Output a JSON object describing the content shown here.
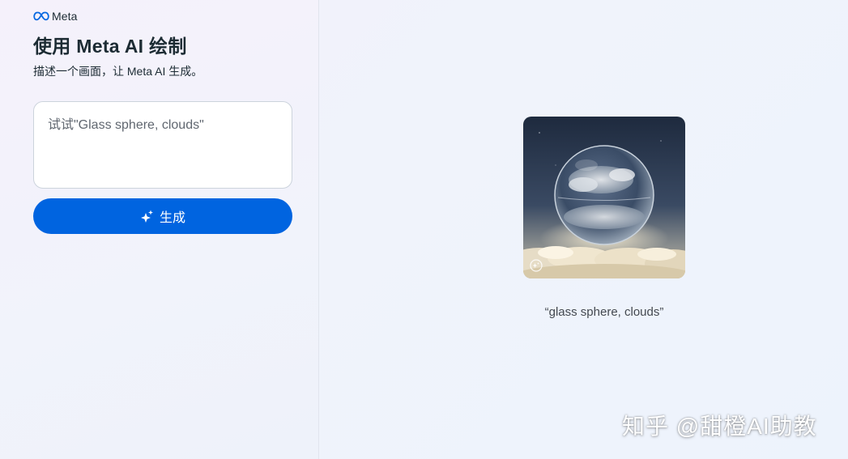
{
  "header": {
    "brand_name": "Meta",
    "logo_icon": "meta-infinity-icon"
  },
  "composer": {
    "title": "使用 Meta AI 绘制",
    "subtitle": "描述一个画面，让 Meta AI 生成。",
    "prompt_value": "",
    "prompt_placeholder": "试试\"Glass sphere, clouds\"",
    "generate_label": "生成",
    "generate_icon": "sparkle-icon"
  },
  "result": {
    "image_subject": "glass sphere above clouds",
    "caption": "“glass sphere, clouds”",
    "badge_icon": "ai-sparkle-badge-icon"
  },
  "watermark": {
    "text": "知乎 @甜橙AI助教"
  },
  "colors": {
    "accent": "#0064e0",
    "text": "#1c2b33",
    "border": "#ccd3dc"
  }
}
